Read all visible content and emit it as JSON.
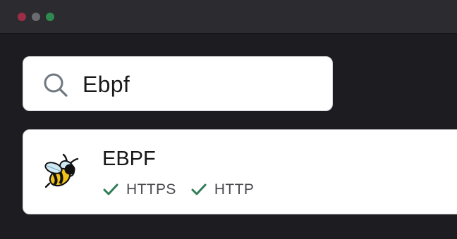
{
  "window": {
    "controls": [
      "close",
      "minimize",
      "zoom"
    ],
    "colors": {
      "close": "#9b2e46",
      "minimize": "#6a6a70",
      "zoom": "#2e8a4e"
    }
  },
  "search": {
    "icon": "search-icon",
    "value": "Ebpf"
  },
  "result": {
    "icon": "bee-icon",
    "title": "EBPF",
    "tags": [
      {
        "icon": "check-icon",
        "label": "HTTPS"
      },
      {
        "icon": "check-icon",
        "label": "HTTP"
      }
    ]
  },
  "colors": {
    "background": "#1c1c21",
    "titlebar": "#2b2b30",
    "card": "#ffffff",
    "check": "#2f7d57"
  }
}
